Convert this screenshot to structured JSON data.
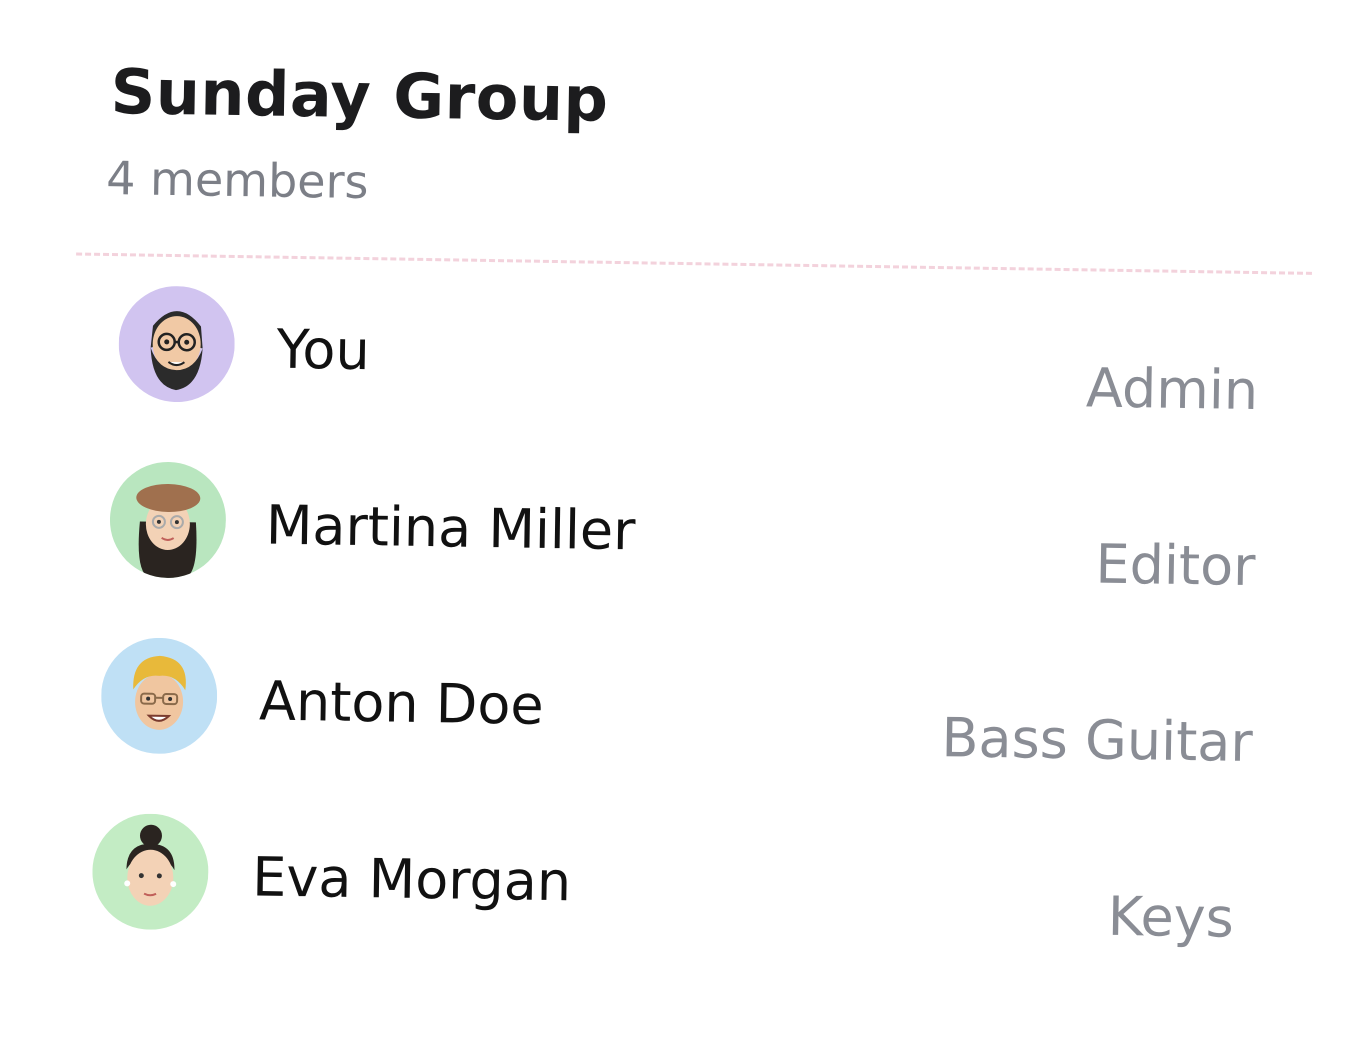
{
  "group": {
    "title": "Sunday Group",
    "member_count": "4 members"
  },
  "members": [
    {
      "name": "You",
      "role": "Admin",
      "avatar_color": "#d1c4f0",
      "avatar_icon": "bearded-man-glasses-avatar-icon"
    },
    {
      "name": "Martina Miller",
      "role": "Editor",
      "avatar_color": "#b9e6bf",
      "avatar_icon": "woman-beret-avatar-icon"
    },
    {
      "name": "Anton Doe",
      "role": "Bass Guitar",
      "avatar_color": "#bfe0f5",
      "avatar_icon": "blond-man-avatar-icon"
    },
    {
      "name": "Eva Morgan",
      "role": "Keys",
      "avatar_color": "#c3ecc4",
      "avatar_icon": "woman-bun-avatar-icon"
    }
  ],
  "colors": {
    "divider": "#f3d2dc",
    "title": "#1c1c1e",
    "muted": "#7c7f87"
  }
}
